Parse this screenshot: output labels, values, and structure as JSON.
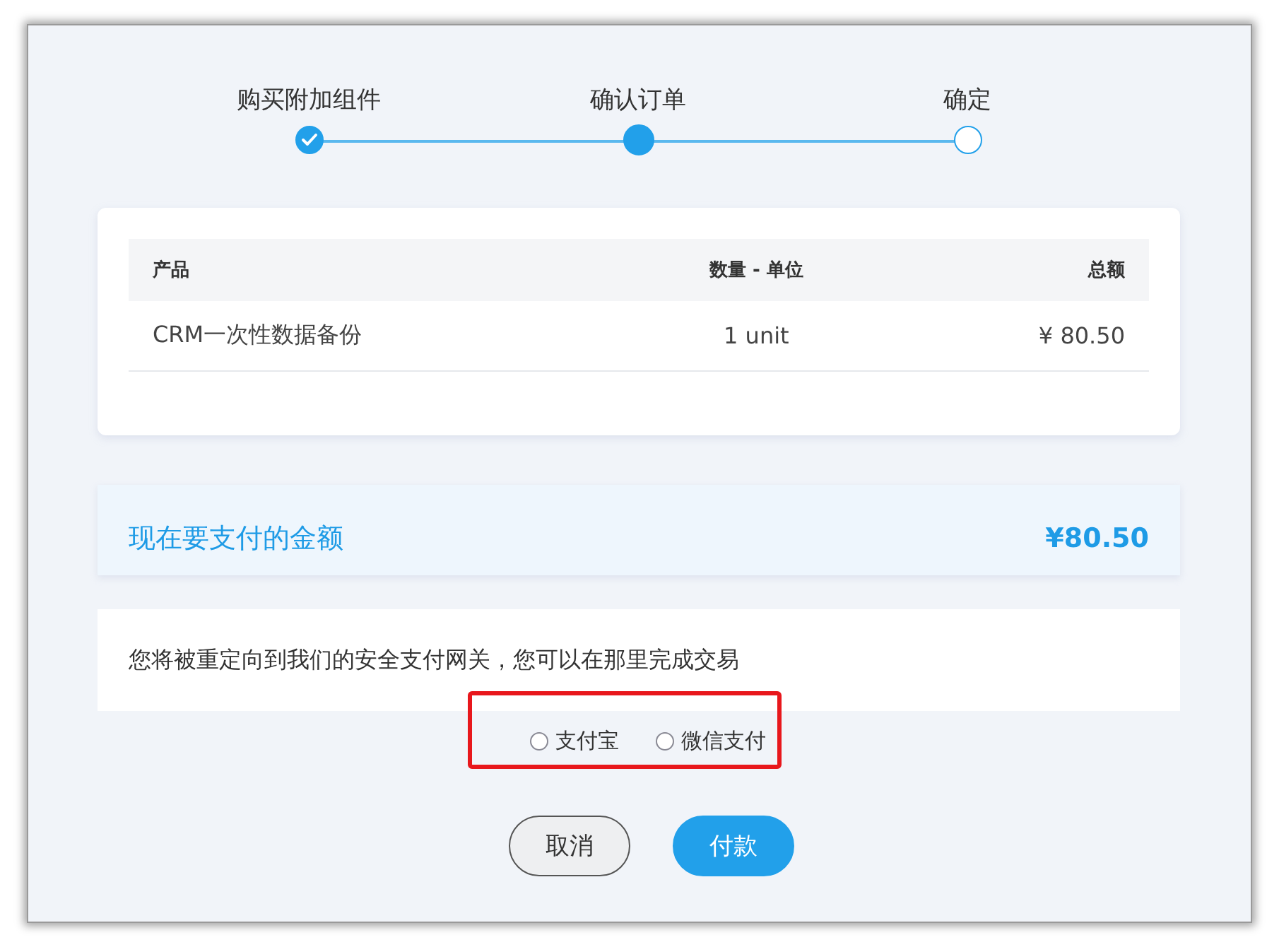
{
  "steps": [
    {
      "label": "购买附加组件",
      "completed": true,
      "selected": false
    },
    {
      "label": "确认订单",
      "completed": false,
      "selected": true
    },
    {
      "label": "确定",
      "completed": false,
      "selected": false
    }
  ],
  "order_table": {
    "columns": [
      "产品",
      "数量 - 单位",
      "总额"
    ],
    "rows": [
      {
        "product": "CRM一次性数据备份",
        "quantity": "1 unit",
        "total": "¥ 80.50"
      }
    ]
  },
  "amount_due": {
    "label": "现在要支付的金额",
    "value": "¥80.50"
  },
  "redirect_notice": "您将被重定向到我们的安全支付网关，您可以在那里完成交易",
  "payment_methods": [
    {
      "label": "支付宝",
      "selected": false
    },
    {
      "label": "微信支付",
      "selected": false
    }
  ],
  "buttons": [
    {
      "label": "取消",
      "kind": "secondary"
    },
    {
      "label": "付款",
      "kind": "primary"
    }
  ]
}
